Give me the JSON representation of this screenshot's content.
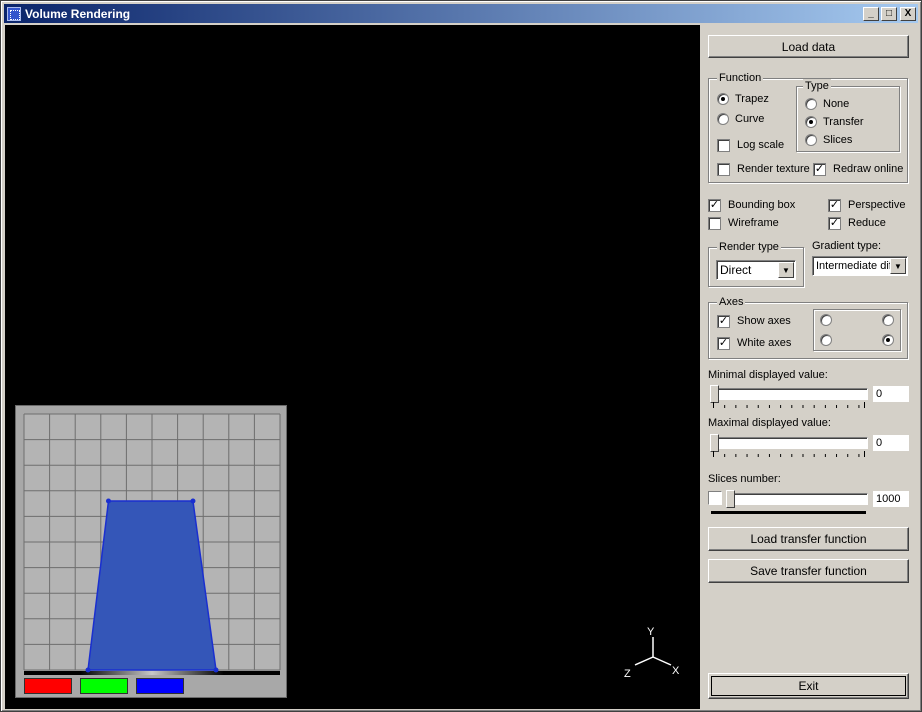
{
  "window": {
    "title": "Volume Rendering",
    "minimize": "_",
    "maximize": "□",
    "close": "X"
  },
  "panel": {
    "load_data": "Load data",
    "function_group": {
      "title": "Function",
      "trapez": "Trapez",
      "curve": "Curve",
      "log_scale": "Log scale",
      "type_group": {
        "title": "Type",
        "none": "None",
        "transfer": "Transfer",
        "slices": "Slices"
      },
      "render_texture": "Render texture",
      "redraw_online": "Redraw online"
    },
    "bounding_box": "Bounding box",
    "perspective": "Perspective",
    "wireframe": "Wireframe",
    "reduce": "Reduce",
    "render_type": {
      "title": "Render type",
      "value": "Direct"
    },
    "gradient_type": {
      "title": "Gradient type:",
      "value": "Intermediate diff"
    },
    "axes_group": {
      "title": "Axes",
      "show_axes": "Show axes",
      "white_axes": "White axes"
    },
    "min_value": {
      "label": "Minimal displayed value:",
      "value": "0"
    },
    "max_value": {
      "label": "Maximal displayed value:",
      "value": "0"
    },
    "slices": {
      "label": "Slices number:",
      "value": "1000"
    },
    "load_tf": "Load transfer function",
    "save_tf": "Save transfer function",
    "exit": "Exit"
  },
  "state": {
    "function": "trapez",
    "type": "transfer",
    "log_scale": false,
    "render_texture": false,
    "redraw_online": true,
    "bounding_box": true,
    "perspective": true,
    "wireframe": false,
    "reduce": true,
    "show_axes": true,
    "white_axes": true,
    "axes_position": "bottom-right"
  },
  "axes_gizmo": {
    "x": "X",
    "y": "Y",
    "z": "Z"
  },
  "transfer_function": {
    "points": [
      [
        0.25,
        0.0
      ],
      [
        0.33,
        0.66
      ],
      [
        0.66,
        0.66
      ],
      [
        0.75,
        0.0
      ]
    ],
    "fill_color": "#3456b8",
    "stroke_color": "#1a2fd0",
    "swatches": [
      "#ff0000",
      "#00ff00",
      "#0000ff"
    ]
  },
  "colors": {
    "face": "#d4d0c8",
    "viewport_bg": "#000000",
    "title_start": "#0a246a",
    "title_end": "#a6caf0"
  }
}
